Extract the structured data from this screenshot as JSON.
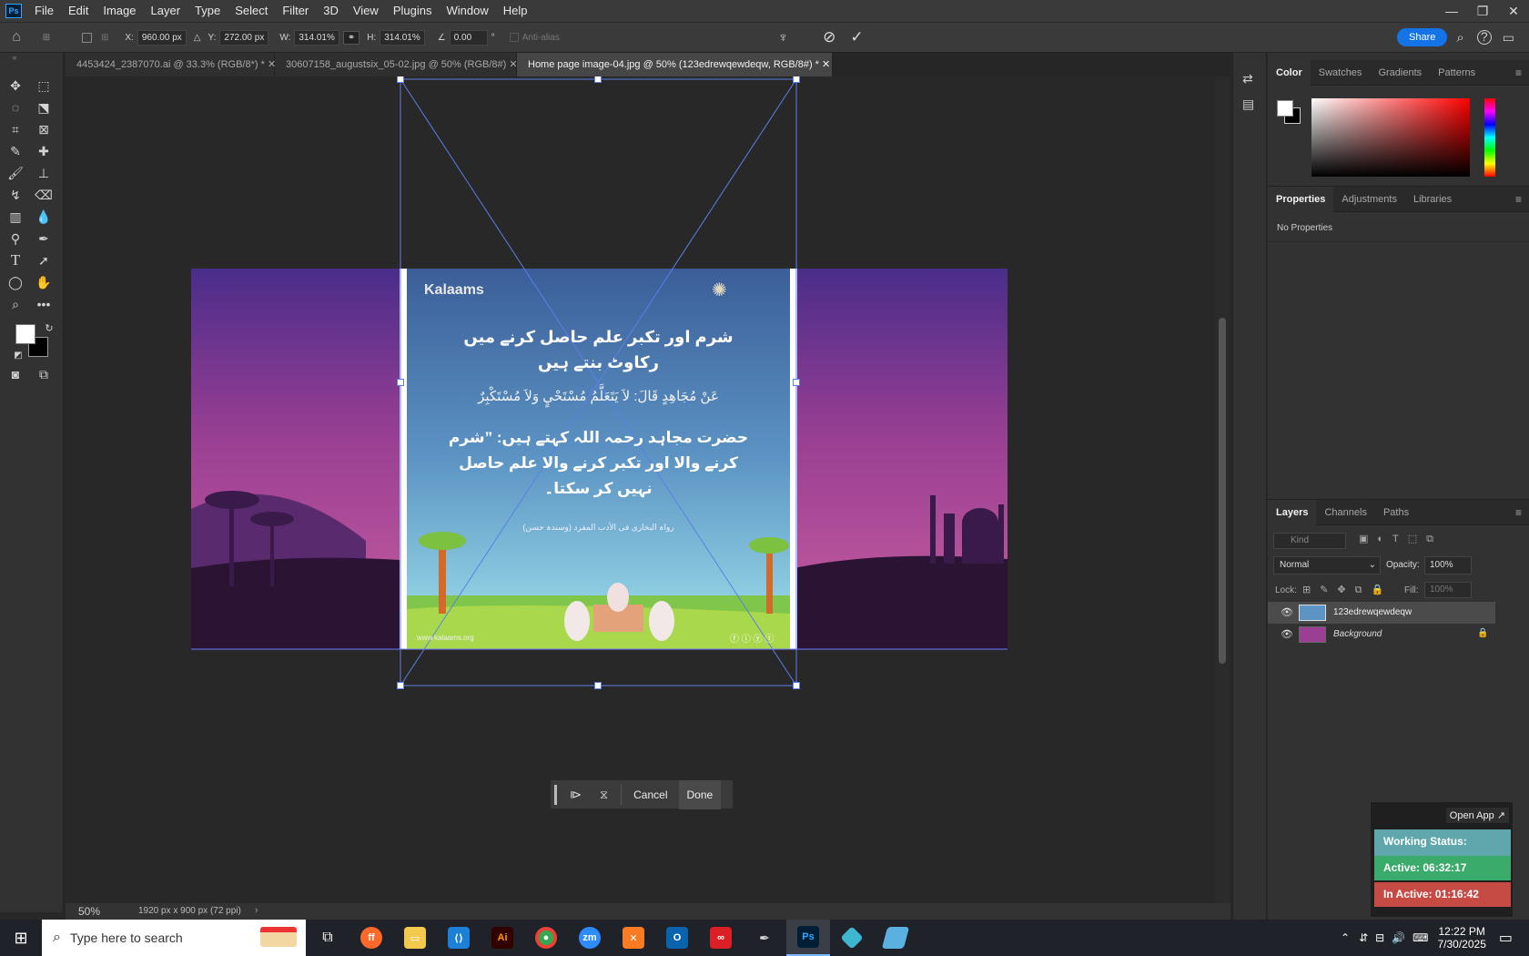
{
  "app": {
    "logo": "Ps"
  },
  "menu": [
    "File",
    "Edit",
    "Image",
    "Layer",
    "Type",
    "Select",
    "Filter",
    "3D",
    "View",
    "Plugins",
    "Window",
    "Help"
  ],
  "options": {
    "x_label": "X:",
    "x_value": "960.00 px",
    "y_label": "Y:",
    "y_value": "272.00 px",
    "w_label": "W:",
    "w_value": "314.01%",
    "h_label": "H:",
    "h_value": "314.01%",
    "angle_value": "0.00",
    "angle_unit": "°",
    "antialias": "Anti-alias",
    "share": "Share"
  },
  "tabs": [
    {
      "label": "4453424_2387070.ai @ 33.3% (RGB/8*) *"
    },
    {
      "label": "30607158_augustsix_05-02.jpg @ 50% (RGB/8#)"
    },
    {
      "label": "Home page image-04.jpg @ 50% (123edrewqewdeqw, RGB/8#) *"
    }
  ],
  "artwork": {
    "logo_text": "Kalaams",
    "urdu_heading_1": "شرم اور تکبر علم حاصل کرنے میں",
    "urdu_heading_2": "رکاوٹ بنتے ہیں",
    "arabic_line": "عَنْ مُجَاهِدٍ قَالَ: لاَ يَتَعَلَّمُ مُسْتَحْيٍ وَلاَ مُسْتَكْبِرٌ",
    "urdu_body_1": "حضرت مجاہد رحمہ اللہ کہتے ہیں: ”شرم",
    "urdu_body_2": "کرنے والا اور تکبر کرنے والا علم حاصل",
    "urdu_body_3": "نہیں کر سکتا۔",
    "reference": "رواہ البخاری فی الأدب المفرد (وسندہ حسن)",
    "footer_url": "www.kalaams.org"
  },
  "contextbar": {
    "cancel": "Cancel",
    "done": "Done"
  },
  "status": {
    "zoom": "50%",
    "doc_info": "1920 px x 900 px (72 ppi)"
  },
  "color_panel": {
    "tabs": [
      "Color",
      "Swatches",
      "Gradients",
      "Patterns"
    ]
  },
  "properties_panel": {
    "tabs": [
      "Properties",
      "Adjustments",
      "Libraries"
    ],
    "content": "No Properties"
  },
  "layers_panel": {
    "tabs": [
      "Layers",
      "Channels",
      "Paths"
    ],
    "kind_placeholder": "Kind",
    "blend_mode": "Normal",
    "opacity_label": "Opacity:",
    "opacity_value": "100%",
    "lock_label": "Lock:",
    "fill_label": "Fill:",
    "fill_value": "100%",
    "layers": [
      {
        "name": "123edrewqewdeqw",
        "selected": true
      },
      {
        "name": "Background",
        "locked": true
      }
    ]
  },
  "widget": {
    "open_app": "Open App ↗",
    "working_status": "Working Status: Active",
    "active_time": "Active: 06:32:17",
    "inactive_time": "In Active: 01:16:42",
    "colors": {
      "working": "#5fa7ac",
      "active": "#3aab6b",
      "inactive": "#c74b45"
    }
  },
  "taskbar": {
    "search_placeholder": "Type here to search",
    "time": "12:22 PM",
    "date": "7/30/2025",
    "apps": [
      "task-view",
      "firefox",
      "file-explorer",
      "vscode",
      "illustrator",
      "chrome",
      "zoom",
      "xampp",
      "outlook",
      "creative-cloud",
      "pen-tool",
      "photoshop",
      "app-blue",
      "app-tilted"
    ]
  }
}
